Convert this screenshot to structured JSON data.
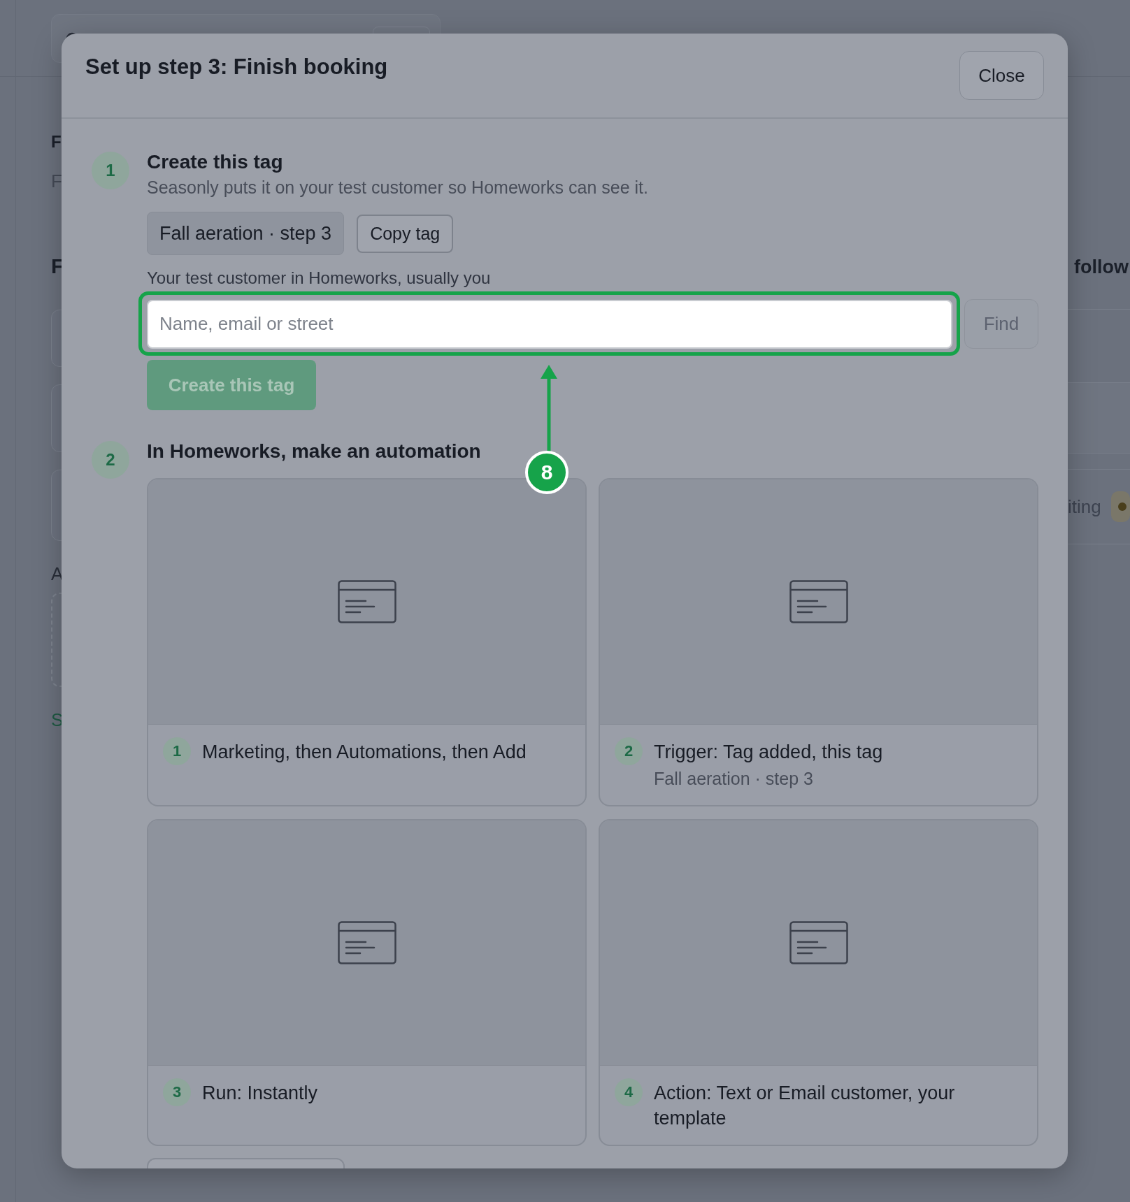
{
  "background": {
    "left_texts": [
      {
        "kind": "heading",
        "text": "F"
      },
      {
        "kind": "subtitle",
        "text": "F"
      },
      {
        "kind": "section",
        "text": "F"
      },
      {
        "kind": "label",
        "text": "A"
      },
      {
        "kind": "link",
        "text": "S"
      }
    ],
    "right_texts": [
      {
        "kind": "heading",
        "text": "follow"
      },
      {
        "kind": "row",
        "text": "iting"
      }
    ]
  },
  "modal": {
    "title": "Set up step 3: Finish booking",
    "close_label": "Close",
    "step_1": {
      "number": "1",
      "title": "Create this tag",
      "description": "Seasonly puts it on your test customer so Homeworks can see it.",
      "tag": "Fall aeration · step 3",
      "copy_label": "Copy tag",
      "field_label": "Your test customer in Homeworks, usually you",
      "field": {
        "placeholder": "Name, email or street",
        "highlighted": true
      },
      "find_label": "Find",
      "submit": {
        "label": "Create this tag",
        "disabled": true
      }
    },
    "step_2": {
      "number": "2",
      "title": "In Homeworks, make an automation",
      "cards": [
        {
          "number": "1",
          "title": "Marketing, then Automations, then Add"
        },
        {
          "number": "2",
          "title": "Trigger: Tag added, this tag",
          "detail": "Fall aeration · step 3"
        },
        {
          "number": "3",
          "title": "Run: Instantly"
        },
        {
          "number": "4",
          "title": "Action: Text or Email customer, your template"
        }
      ]
    }
  },
  "callout": {
    "number": "8"
  }
}
